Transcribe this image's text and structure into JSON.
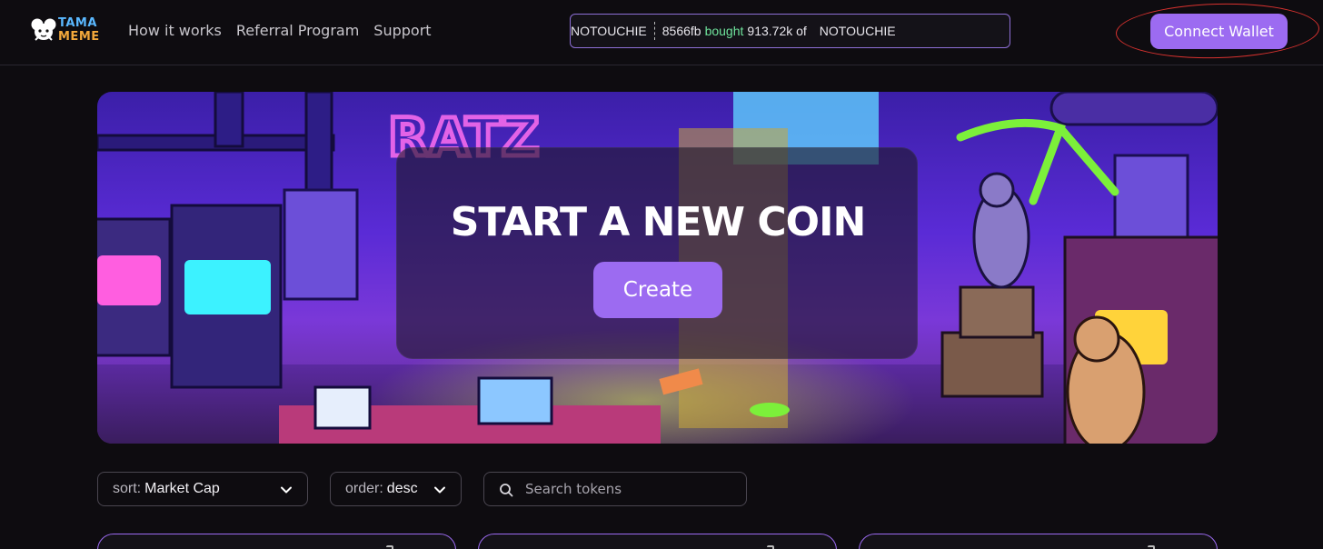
{
  "header": {
    "logo": {
      "line1": "TAMA",
      "line2": "MEME"
    },
    "nav": [
      "How it works",
      "Referral Program",
      "Support"
    ],
    "ticker": {
      "token": "NOTOUCHIE",
      "address": "8566fb",
      "action": "bought",
      "amount": "913.72k of",
      "token_again": "NOTOUCHIE"
    },
    "connect_wallet": "Connect Wallet"
  },
  "hero": {
    "title": "START A NEW COIN",
    "create_button": "Create"
  },
  "filters": {
    "sort_key": "sort:",
    "sort_value": "Market Cap",
    "order_key": "order:",
    "order_value": "desc",
    "search_placeholder": "Search tokens"
  },
  "colors": {
    "accent": "#9c6bf1",
    "bought": "#6fe39c",
    "annotation": "#d8322f",
    "background": "#0e0c10"
  },
  "icons": [
    "mouse-logo-icon",
    "chevron-down-icon",
    "search-icon"
  ]
}
